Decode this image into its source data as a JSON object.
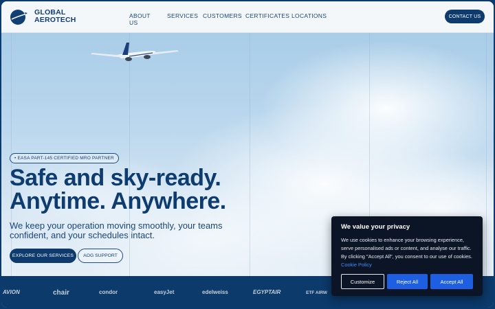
{
  "header": {
    "logo_line1": "GLOBAL",
    "logo_line2": "AEROTECH",
    "nav": [
      "ABOUT US",
      "SERVICES",
      "CUSTOMERS",
      "CERTIFICATES",
      "LOCATIONS"
    ],
    "contact_label": "CONTACT US"
  },
  "hero": {
    "badge": "• EASA PART-145 CERTIFIED MRO PARTNER",
    "headline_line1": "Safe and sky-ready.",
    "headline_line2": "Anytime. Anywhere.",
    "subline": "We keep your operation moving smoothly, your teams confident, and your schedules intact.",
    "primary_button": "EXPLORE OUR SERVICES",
    "secondary_button": "AOG SUPPORT"
  },
  "strip": {
    "airlines": [
      "AVION",
      "chair",
      "condor",
      "easyJet",
      "edelweiss",
      "EGYPTAIR",
      "ETF AIRW"
    ]
  },
  "cookie": {
    "title": "We value your privacy",
    "text": "We use cookies to enhance your browsing experience, serve personalised ads or content, and analyse our traffic. By clicking \"Accept All\", you consent to our use of cookies.",
    "link": "Cookie Policy",
    "customize": "Customize",
    "reject": "Reject All",
    "accept": "Accept All"
  },
  "colors": {
    "brand_navy": "#0d3b6d",
    "cookie_bg": "#0c1526",
    "cookie_button": "#1d5fe0",
    "link": "#3d8bff"
  }
}
